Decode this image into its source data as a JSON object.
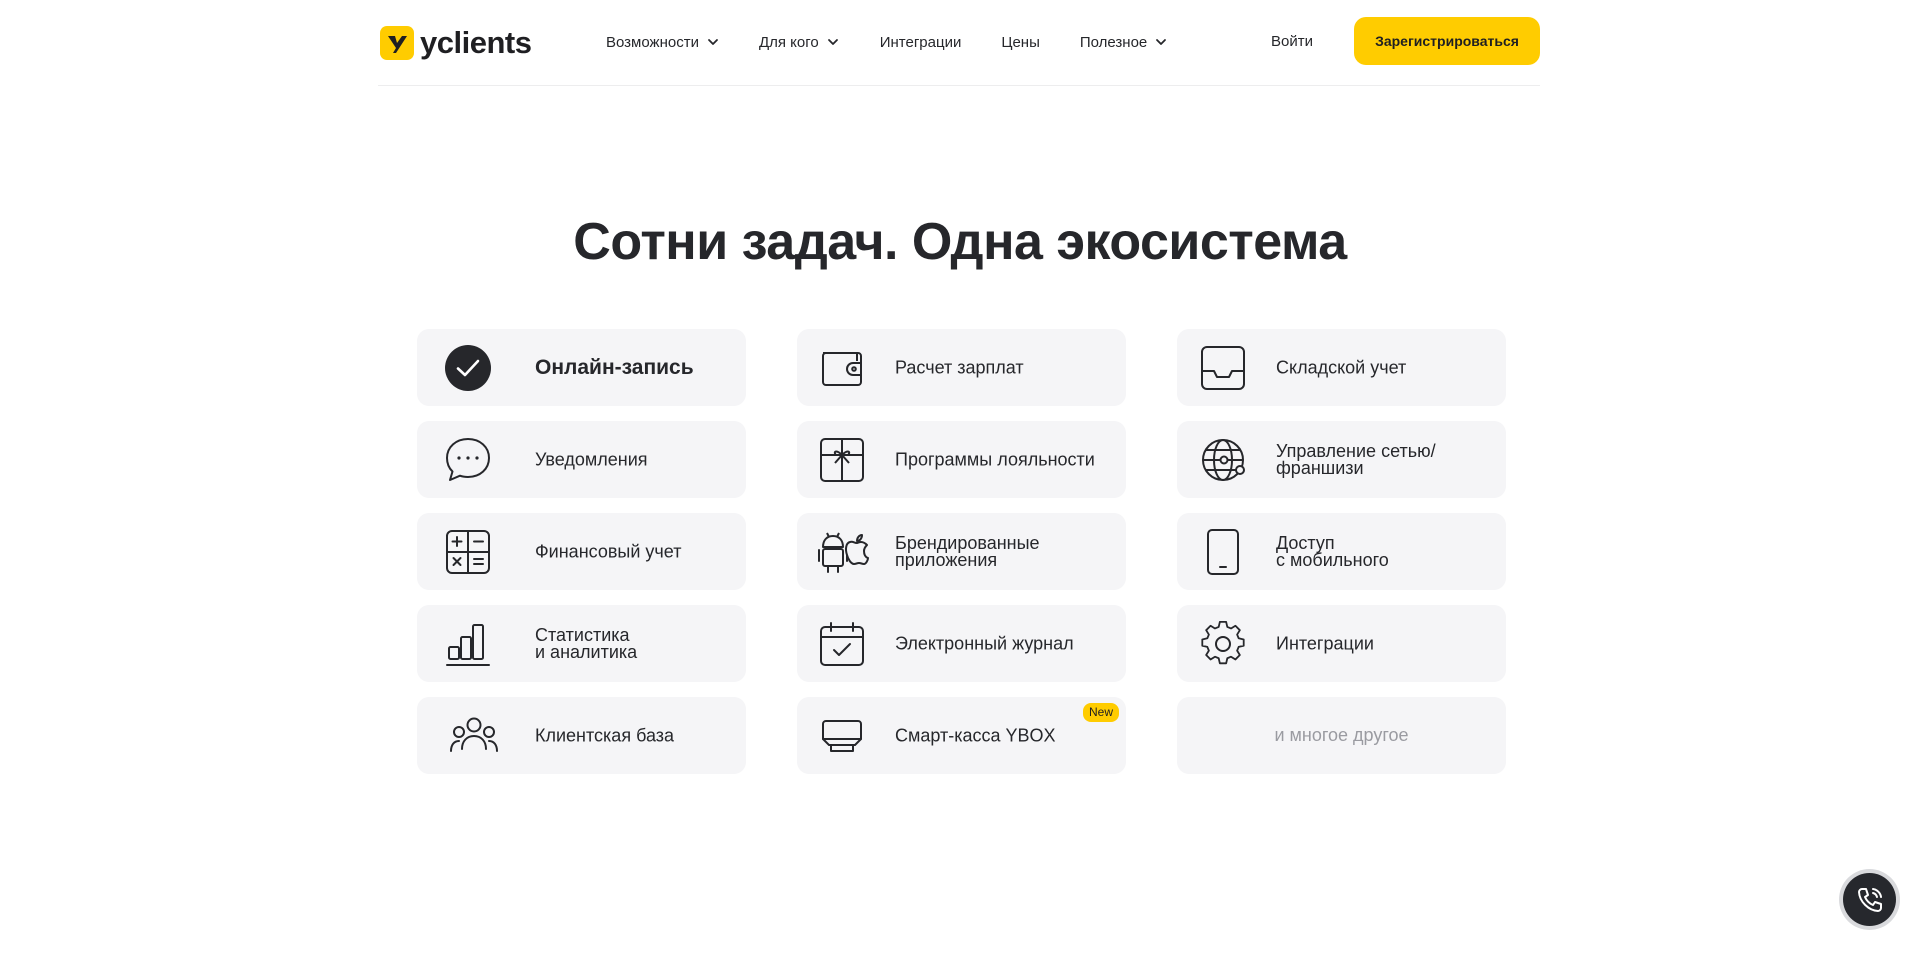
{
  "brand": {
    "name": "yclients",
    "accent": "#ffcc00",
    "dark": "#26272b"
  },
  "nav": {
    "items": [
      {
        "label": "Возможности",
        "dropdown": true
      },
      {
        "label": "Для кого",
        "dropdown": true
      },
      {
        "label": "Интеграции",
        "dropdown": false
      },
      {
        "label": "Цены",
        "dropdown": false
      },
      {
        "label": "Полезное",
        "dropdown": true
      }
    ],
    "login": "Войти",
    "register": "Зарегистрироваться"
  },
  "section": {
    "title": "Сотни задач. Одна экосистема"
  },
  "features": [
    {
      "label": "Онлайн-запись",
      "icon": "check-circle-icon",
      "active": true
    },
    {
      "label": "Расчет зарплат",
      "icon": "wallet-icon"
    },
    {
      "label": "Складской учет",
      "icon": "inbox-tray-icon"
    },
    {
      "label": "Уведомления",
      "icon": "chat-bubble-icon"
    },
    {
      "label": "Программы лояльности",
      "icon": "gift-icon"
    },
    {
      "label": "Управление сетью/\nфраншизи",
      "icon": "globe-network-icon"
    },
    {
      "label": "Финансовый учет",
      "icon": "calculator-icon"
    },
    {
      "label": "Брендированные\nприложения",
      "icon": "android-apple-icon"
    },
    {
      "label": "Доступ\nс мобильного",
      "icon": "smartphone-icon"
    },
    {
      "label": "Статистика\nи аналитика",
      "icon": "bar-chart-icon"
    },
    {
      "label": "Электронный журнал",
      "icon": "calendar-check-icon"
    },
    {
      "label": "Интеграции",
      "icon": "gear-icon"
    },
    {
      "label": "Клиентская база",
      "icon": "users-icon"
    },
    {
      "label": "Смарт-касса YBOX",
      "icon": "cash-register-icon",
      "badge": "New"
    },
    {
      "label": "и многое другое",
      "icon": null,
      "more": true
    }
  ],
  "call_button": {
    "icon": "phone-icon"
  }
}
